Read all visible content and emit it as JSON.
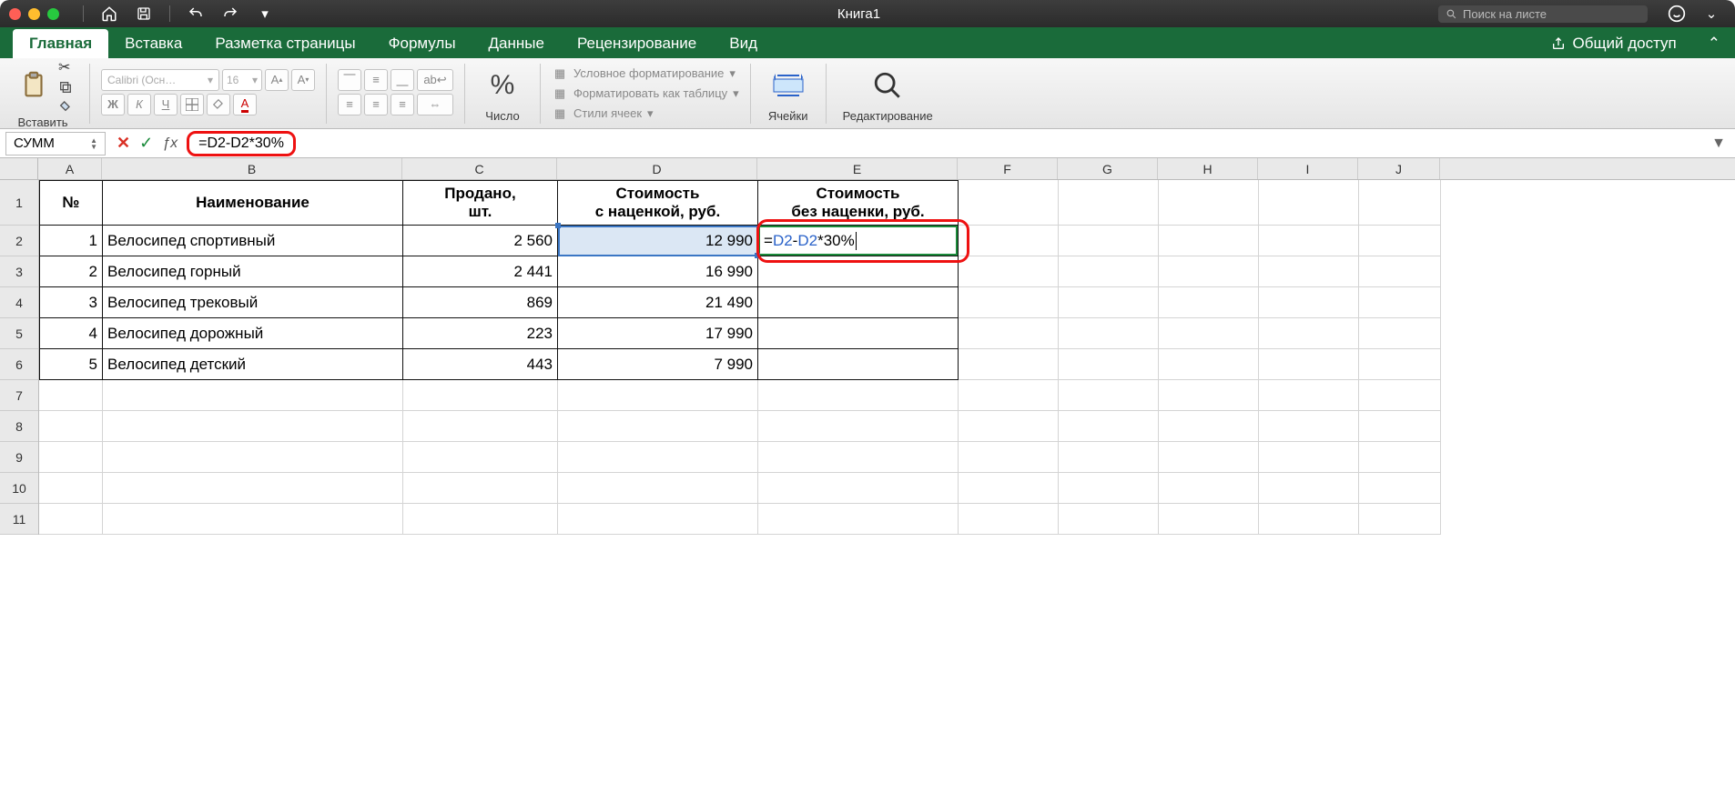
{
  "titlebar": {
    "title": "Книга1",
    "search_placeholder": "Поиск на листе"
  },
  "tabs": {
    "items": [
      "Главная",
      "Вставка",
      "Разметка страницы",
      "Формулы",
      "Данные",
      "Рецензирование",
      "Вид"
    ],
    "active": 0,
    "share": "Общий доступ"
  },
  "ribbon": {
    "paste": "Вставить",
    "font_name": "Calibri (Осн…",
    "font_size": "16",
    "bold": "Ж",
    "italic": "К",
    "underline": "Ч",
    "font_grow": "A",
    "font_shrink": "A",
    "number_label": "Число",
    "cond_fmt": "Условное форматирование",
    "as_table": "Форматировать как таблицу",
    "cell_styles": "Стили ячеек",
    "cells": "Ячейки",
    "editing": "Редактирование",
    "percent": "%",
    "wrap": "ab"
  },
  "formula_bar": {
    "name_box": "СУММ",
    "formula": "=D2-D2*30%"
  },
  "columns": {
    "labels": [
      "A",
      "B",
      "C",
      "D",
      "E",
      "F",
      "G",
      "H",
      "I",
      "J"
    ],
    "widths": [
      70,
      330,
      170,
      220,
      220,
      110,
      110,
      110,
      110,
      90
    ]
  },
  "sheet": {
    "headers": [
      "№",
      "Наименование",
      "Продано,\nшт.",
      "Стоимость\nс наценкой, руб.",
      "Стоимость\nбез наценки, руб."
    ],
    "rows": [
      {
        "n": "1",
        "name": "Велосипед спортивный",
        "sold": "2 560",
        "price": "12 990",
        "e": "=D2-D2*30%"
      },
      {
        "n": "2",
        "name": "Велосипед горный",
        "sold": "2 441",
        "price": "16 990",
        "e": ""
      },
      {
        "n": "3",
        "name": "Велосипед трековый",
        "sold": "869",
        "price": "21 490",
        "e": ""
      },
      {
        "n": "4",
        "name": "Велосипед дорожный",
        "sold": "223",
        "price": "17 990",
        "e": ""
      },
      {
        "n": "5",
        "name": "Велосипед детский",
        "sold": "443",
        "price": "7 990",
        "e": ""
      }
    ],
    "empty_rows": [
      7,
      8,
      9,
      10,
      11
    ]
  },
  "chart_data": {
    "type": "table",
    "title": "",
    "columns": [
      "№",
      "Наименование",
      "Продано, шт.",
      "Стоимость с наценкой, руб.",
      "Стоимость без наценки, руб."
    ],
    "rows": [
      [
        1,
        "Велосипед спортивный",
        2560,
        12990,
        null
      ],
      [
        2,
        "Велосипед горный",
        2441,
        16990,
        null
      ],
      [
        3,
        "Велосипед трековый",
        869,
        21490,
        null
      ],
      [
        4,
        "Велосипед дорожный",
        223,
        17990,
        null
      ],
      [
        5,
        "Велосипед детский",
        443,
        7990,
        null
      ]
    ],
    "active_formula": {
      "cell": "E2",
      "formula": "=D2-D2*30%"
    }
  }
}
